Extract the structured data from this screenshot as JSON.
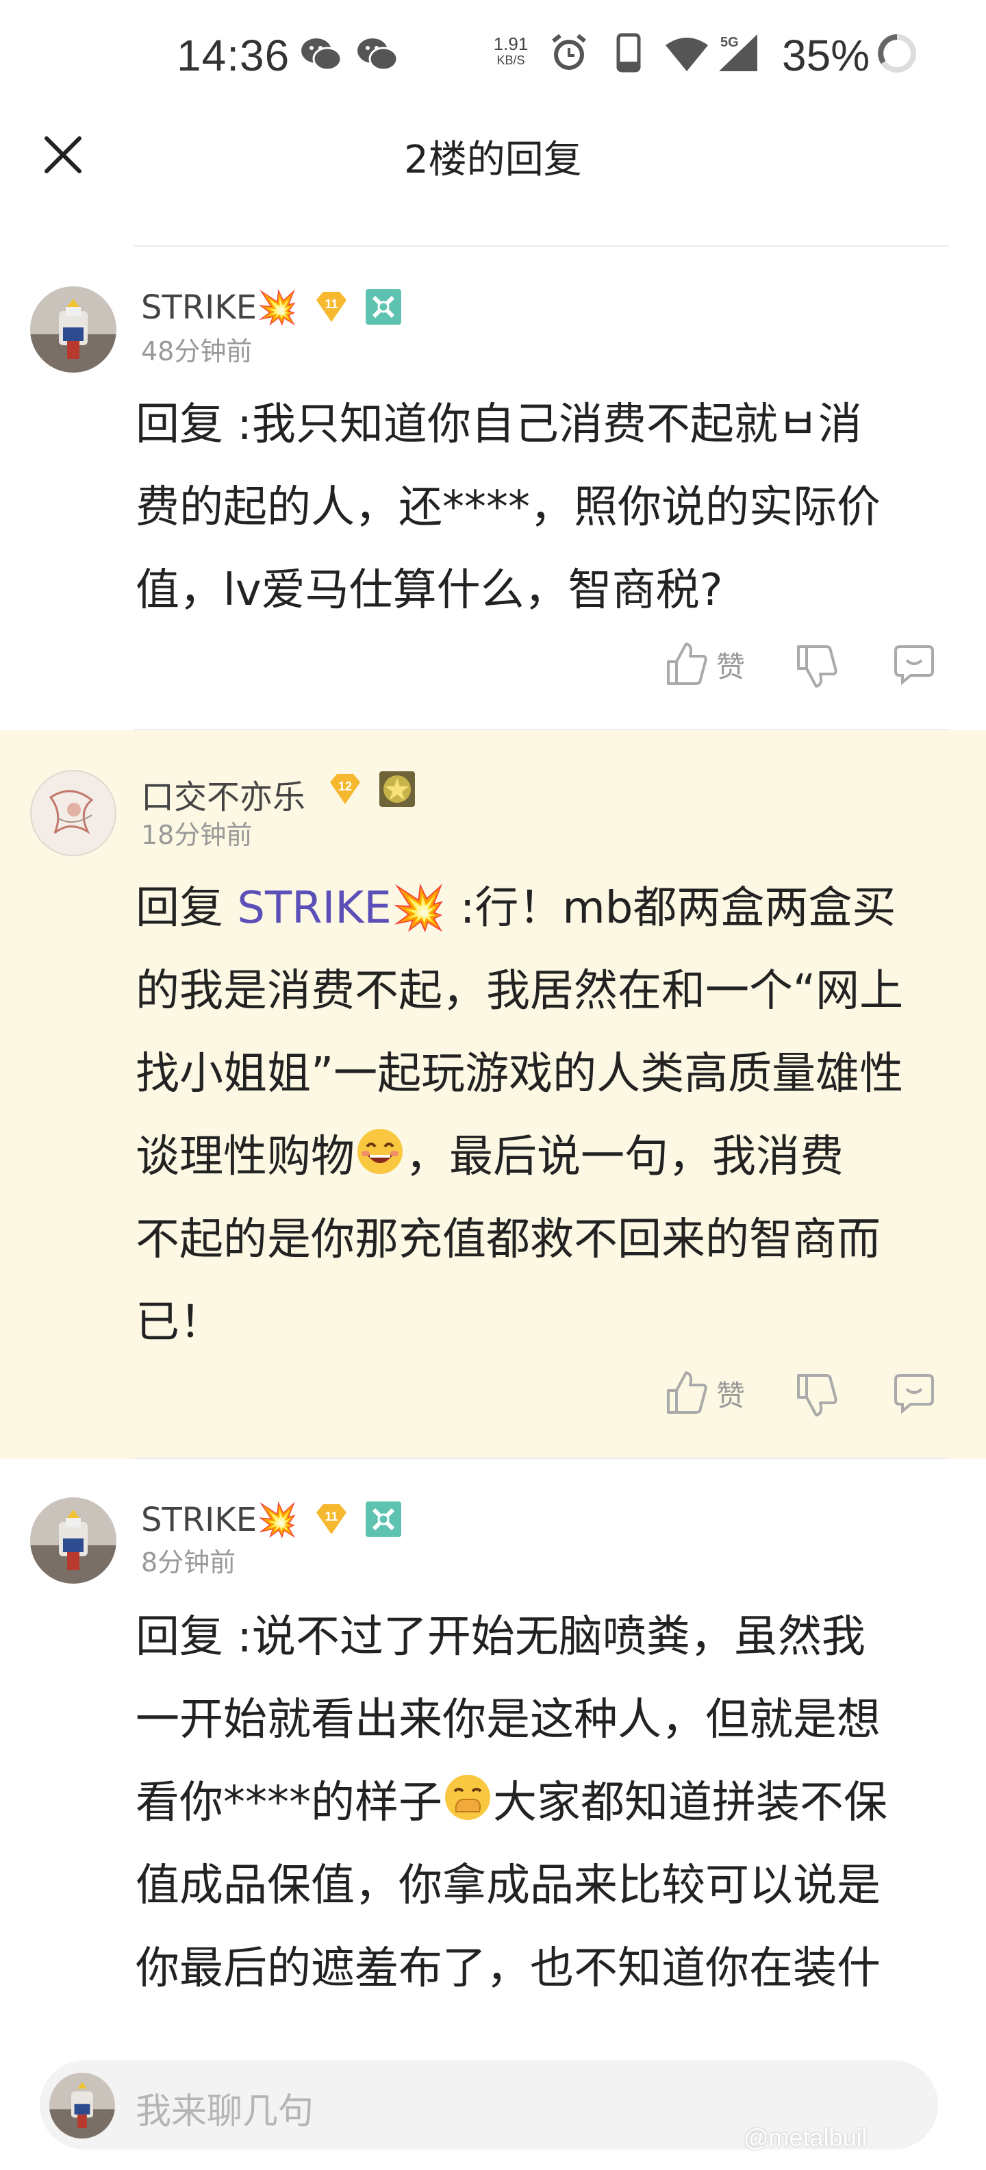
{
  "status_bar": {
    "time": "14:36",
    "speed_value": "1.91",
    "speed_unit": "KB/S",
    "network": "5G",
    "battery": "35%",
    "icons": [
      "wechat-icon",
      "wechat-icon",
      "alarm-icon",
      "phone-icon",
      "wifi-icon",
      "signal-icon",
      "battery-ring-icon"
    ]
  },
  "header": {
    "title": "2楼的回复",
    "close_icon": "close-icon"
  },
  "comments": [
    {
      "username": "STRIKE💥",
      "level": "11",
      "time": "48分钟前",
      "reply_prefix": "回复",
      "reply_to": "",
      "text_lines": [
        ":我只知道你自己消费不起就ㅂ消",
        "费的起的人，还****，照你说的实际价",
        "值，lv爱马仕算什么，智商税?"
      ],
      "like_label": "赞"
    },
    {
      "username": "口交不亦乐",
      "level": "12",
      "time": "18分钟前",
      "reply_prefix": "回复",
      "reply_to": "STRIKE💥",
      "text_lines": [
        ":行！mb都两盒两盒买",
        "的我是消费不起，我居然在和一个“网上",
        "找小姐姐”一起玩游戏的人类高质量雄性",
        "谈理性购物",
        "，最后说一句，我消费",
        "不起的是你那充值都救不回来的智商而",
        "已！"
      ],
      "like_label": "赞"
    },
    {
      "username": "STRIKE💥",
      "level": "11",
      "time": "8分钟前",
      "reply_prefix": "回复",
      "reply_to": "",
      "text_lines": [
        ":说不过了开始无脑喷粪，虽然我",
        "一开始就看出来你是这种人，但就是想",
        "看你****的样子",
        "大家都知道拼装不保",
        "值成品保值，你拿成品来比较可以说是",
        "你最后的遮羞布了，也不知道你在装什"
      ]
    }
  ],
  "input_bar": {
    "placeholder": "我来聊几句",
    "watermark": "@metalbuil"
  },
  "colors": {
    "highlight_bg": "#fdf8e4",
    "reply_link": "#5b4fb8",
    "badge_gold": "#f5b82e",
    "badge_teal": "#5ec2b0"
  }
}
